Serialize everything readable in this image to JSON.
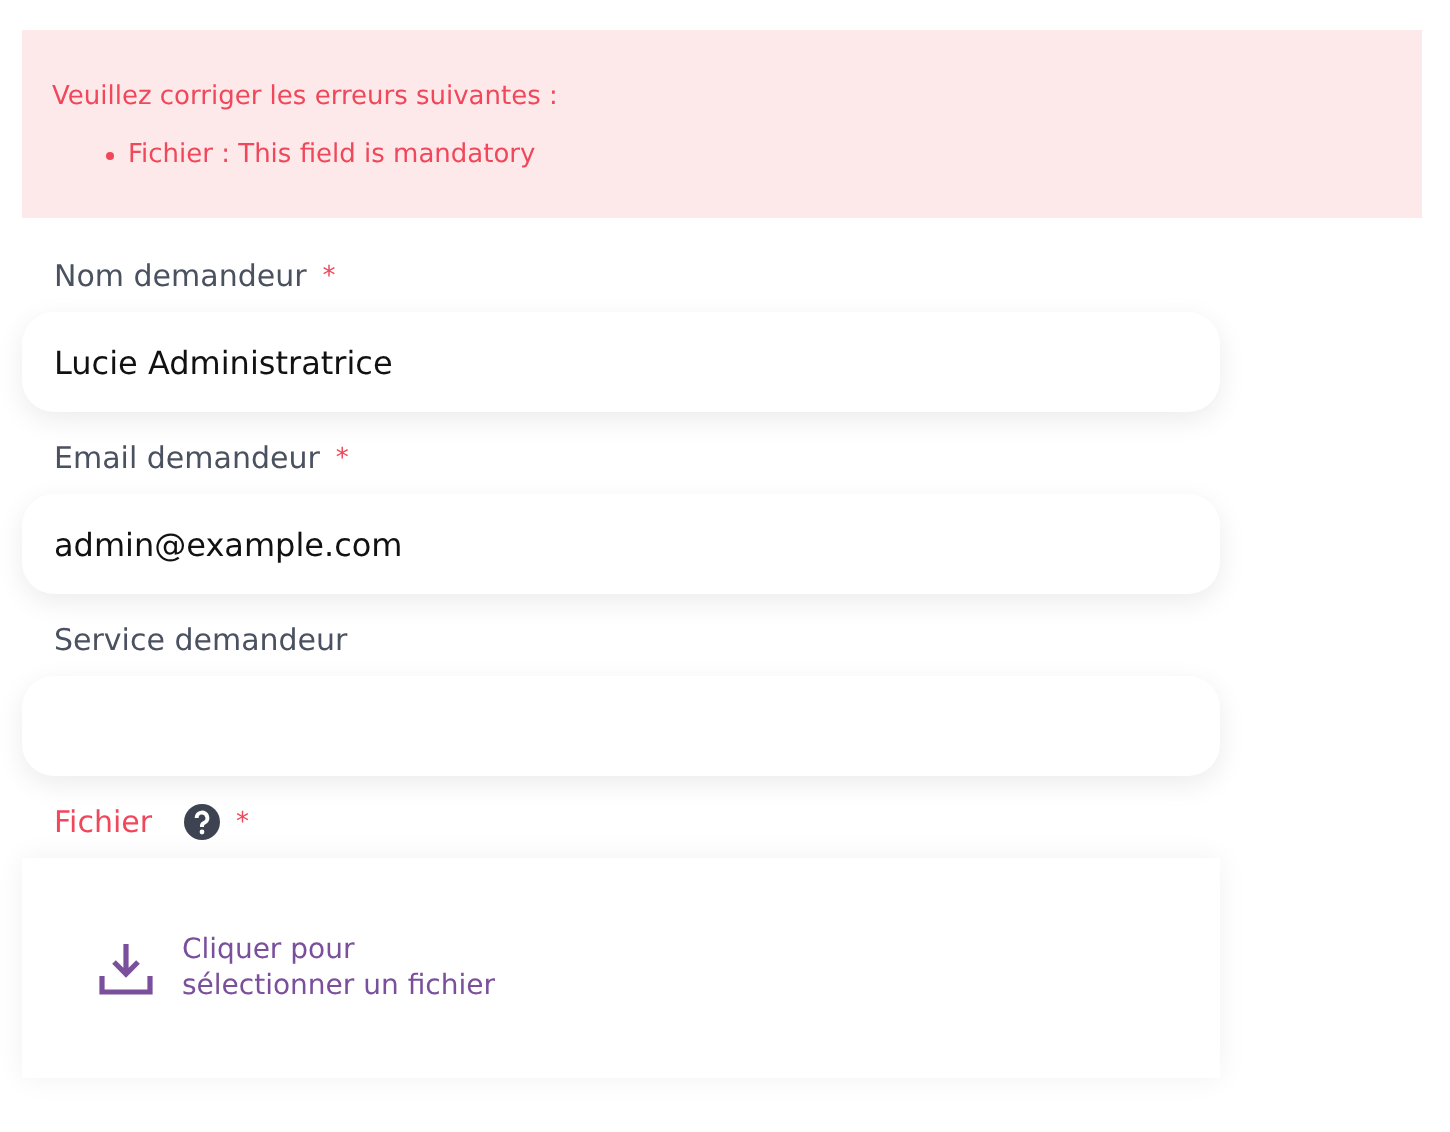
{
  "error_panel": {
    "title": "Veuillez corriger les erreurs suivantes :",
    "errors": [
      "Fichier : This field is mandatory"
    ]
  },
  "fields": [
    {
      "kind": "text",
      "label": "Nom demandeur",
      "required_mark": "*",
      "error": false,
      "value": "Lucie Administratrice"
    },
    {
      "kind": "text",
      "label": "Email demandeur",
      "required_mark": "*",
      "error": false,
      "value": "admin@example.com"
    },
    {
      "kind": "text",
      "label": "Service demandeur",
      "error": false
    },
    {
      "kind": "file",
      "label": "Fichier",
      "required_mark": "*",
      "error": true,
      "help": true,
      "prompt_lines": [
        "Cliquer pour",
        "sélectionner un fichier"
      ]
    }
  ]
}
